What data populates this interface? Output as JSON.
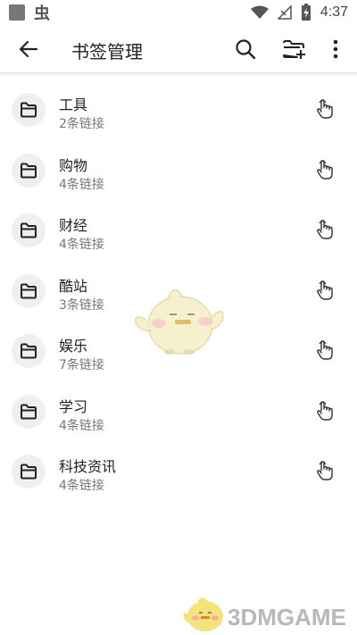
{
  "status_bar": {
    "notification_app_glyph": "虫",
    "time": "4:37",
    "icons": [
      "square-app-icon",
      "bug-icon",
      "wifi-icon",
      "no-signal-icon",
      "battery-charging-icon"
    ]
  },
  "app_bar": {
    "title": "书签管理",
    "icons": [
      "back-arrow-icon",
      "search-icon",
      "folder-add-icon",
      "more-vert-icon"
    ]
  },
  "folders": [
    {
      "name": "工具",
      "count": "2条链接"
    },
    {
      "name": "购物",
      "count": "4条链接"
    },
    {
      "name": "财经",
      "count": "4条链接"
    },
    {
      "name": "酷站",
      "count": "3条链接"
    },
    {
      "name": "娱乐",
      "count": "7条链接"
    },
    {
      "name": "学习",
      "count": "4条链接"
    },
    {
      "name": "科技资讯",
      "count": "4条链接"
    }
  ],
  "row_icons": {
    "leading": "folder-icon",
    "trailing": "touch-drag-icon"
  },
  "watermark": {
    "text": "3DMGAME"
  },
  "colors": {
    "accent": "#222222",
    "secondary_text": "#777777",
    "icon_bg": "#efefef"
  }
}
